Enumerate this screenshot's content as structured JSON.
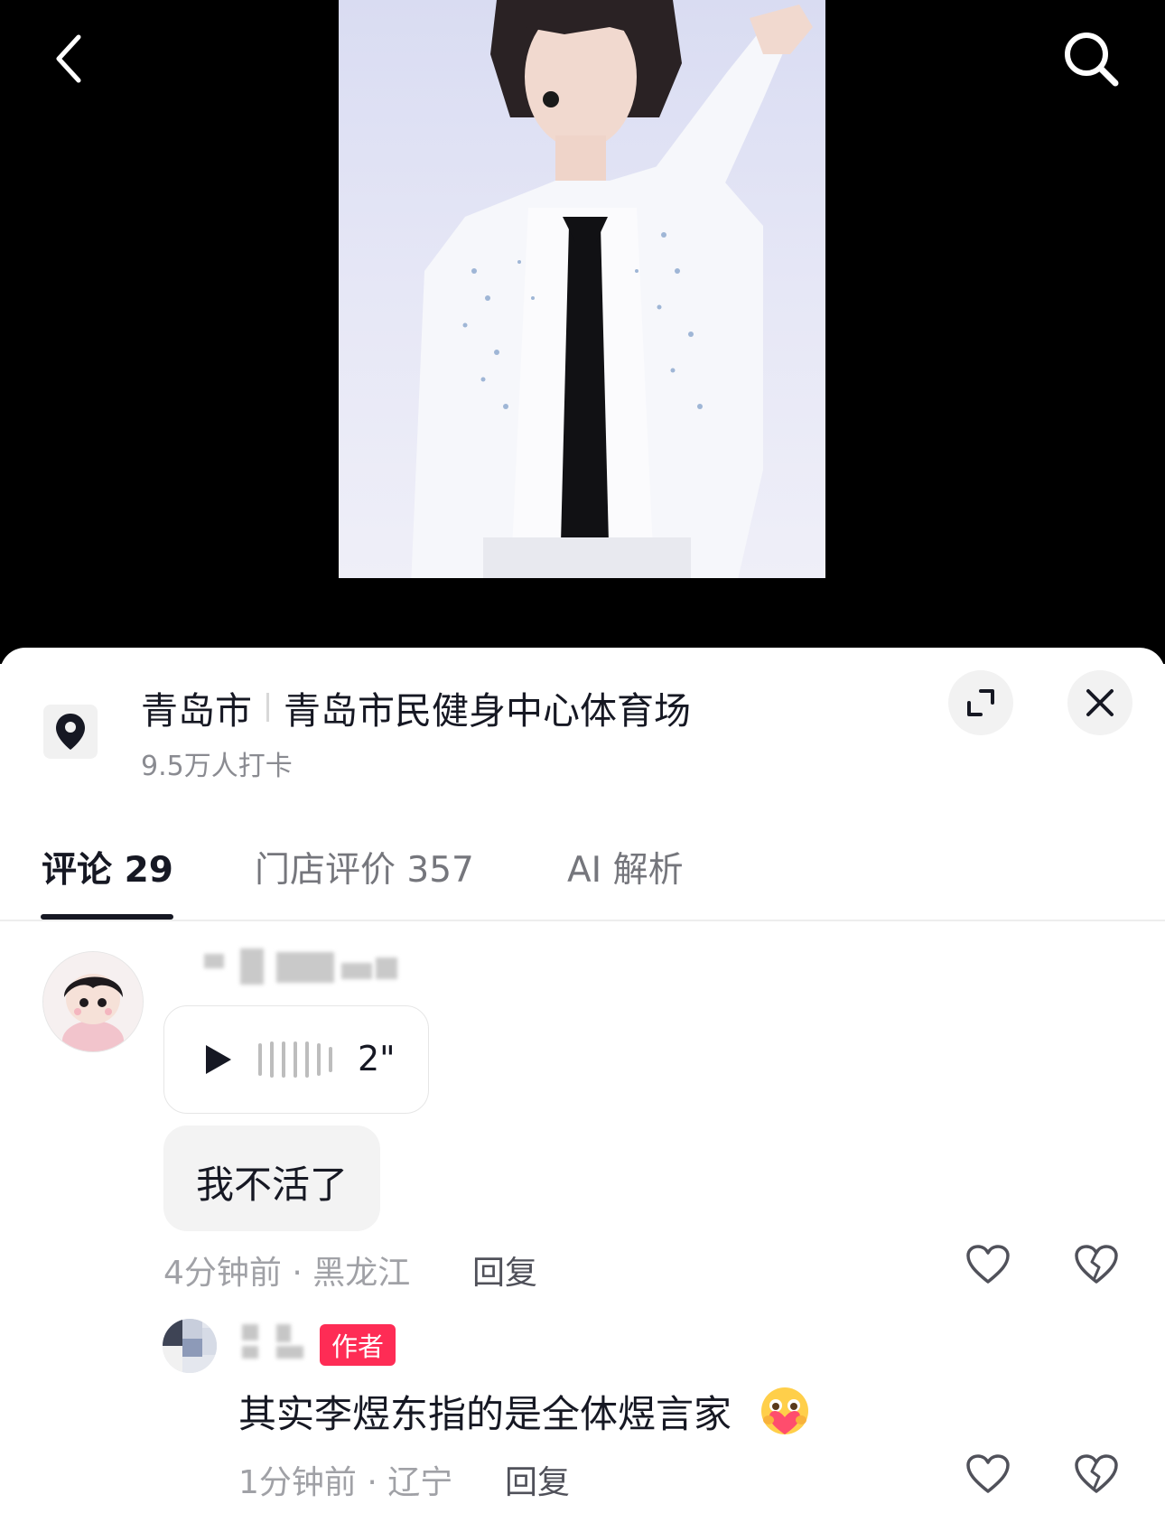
{
  "header": {
    "back_icon": "chevron-left-icon",
    "search_icon": "search-icon"
  },
  "location": {
    "icon": "map-pin-icon",
    "city": "青岛市",
    "venue": "青岛市民健身中心体育场",
    "checkins": "9.5万人打卡"
  },
  "actions": {
    "expand_icon": "expand-icon",
    "close_icon": "close-icon"
  },
  "tabs": [
    {
      "label": "评论 29",
      "active": true
    },
    {
      "label": "门店评价 357",
      "active": false
    },
    {
      "label": "AI 解析",
      "active": false
    }
  ],
  "comments": [
    {
      "voice_duration": "2\"",
      "text": "我不活了",
      "time_location": "4分钟前 · 黑龙江",
      "reply_label": "回复"
    }
  ],
  "replies": [
    {
      "badge": "作者",
      "text": "其实李煜东指的是全体煜言家",
      "emoji_icon": "heart-hug-emoji-icon",
      "time_location": "1分钟前 · 辽宁",
      "reply_label": "回复"
    }
  ],
  "colors": {
    "accent": "#fe2c55",
    "text_primary": "#161823",
    "text_secondary": "#a0a1a6"
  }
}
